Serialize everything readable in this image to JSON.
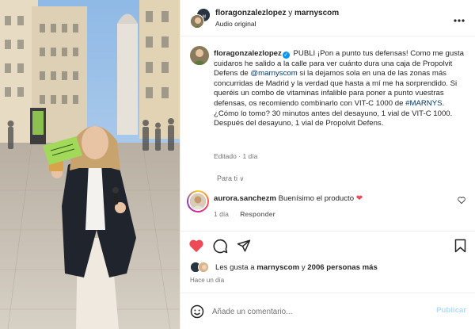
{
  "header": {
    "user_primary": "floragonzalezlopez",
    "joiner": "y",
    "user_secondary": "marnyscom",
    "audio": "Audio original",
    "more_icon": "more-horizontal-icon"
  },
  "caption": {
    "username": "floragonzalezlopez",
    "verified": "✓",
    "segments": {
      "s1": "PUBLI ¡Pon a punto tus defensas! Como me gusta cuidaros he salido a la calle para ver cuánto dura una caja de Propolvit Defens de ",
      "mention": "@marnyscom",
      "s2": " si la dejamos sola en una de las zonas más concurridas de Madrid y la verdad que hasta a mí me ha sorprendido. Si queréis un combo de vitaminas infalible para poner a punto vuestras defensas, os recomiendo combinarlo con VIT-C 1000 de ",
      "hashtag": "#MARNYS",
      "s3": ". ¿Cómo lo tomo? 30 minutos antes del desayuno, 1 vial de VIT-C 1000. Después del desayuno, 1 vial de Propolvit Defens."
    },
    "edited": "Editado",
    "dot": "·",
    "time": "1 día"
  },
  "for_you": {
    "label": "Para ti",
    "chevron": "∨"
  },
  "comment": {
    "username": "aurora.sanchezm",
    "text": "Buenísimo el producto",
    "emoji": "❤",
    "time": "1 día",
    "reply": "Responder"
  },
  "likes": {
    "prefix": "Les gusta a",
    "user": "marnyscom",
    "joiner": "y",
    "count": "2006 personas más"
  },
  "date": "Hace un día",
  "add_comment": {
    "placeholder": "Añade un comentario...",
    "publish": "Publicar"
  },
  "colors": {
    "like_red": "#ed4956",
    "verified_blue": "#0095f6",
    "link": "#00376b",
    "publish_disabled": "#b3dbff"
  }
}
